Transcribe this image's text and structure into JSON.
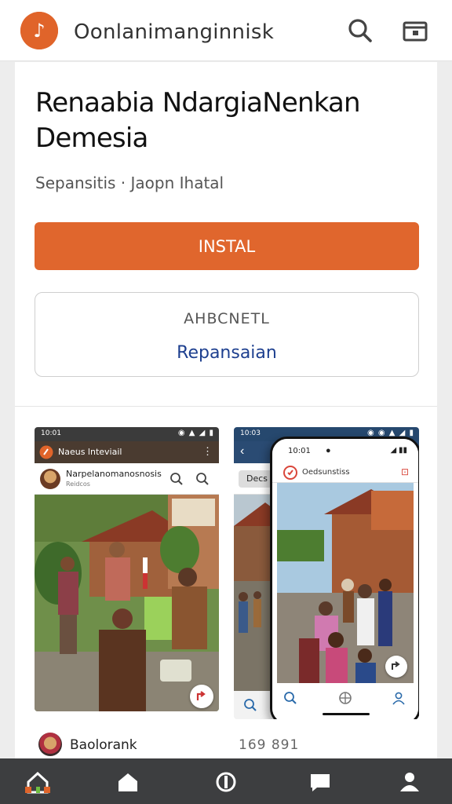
{
  "header": {
    "app_name": "Oonlanimanginnisk",
    "logo_glyph": "♪",
    "icons": [
      "search-icon",
      "tab-switcher-icon"
    ]
  },
  "app": {
    "title": "Renaabia NdargiaNenkan Demesia",
    "developer": "Sepansitis",
    "category": "Jaopn Ihatal",
    "install_label": "INSTAL",
    "info_label": "AHBCNETL",
    "info_link": "Repansaian"
  },
  "screenshots": [
    {
      "time": "10:01",
      "app_header": "Naeus lnteviail",
      "post_title": "Narpelanomanosnosis",
      "post_subtitle": "Reidcos"
    },
    {
      "time": "10:03",
      "left_header": "Decs",
      "phone_time": "10:01",
      "phone_header": "Oedsunstiss"
    }
  ],
  "footer": {
    "reviewer_name": "Baolorank",
    "count": "169 891"
  },
  "bottom_nav": [
    "home-icon",
    "house-icon",
    "compass-icon",
    "chat-icon",
    "profile-icon"
  ],
  "colors": {
    "accent": "#e0642a",
    "link": "#1d3f8f",
    "nav_background": "#3d3e40"
  }
}
